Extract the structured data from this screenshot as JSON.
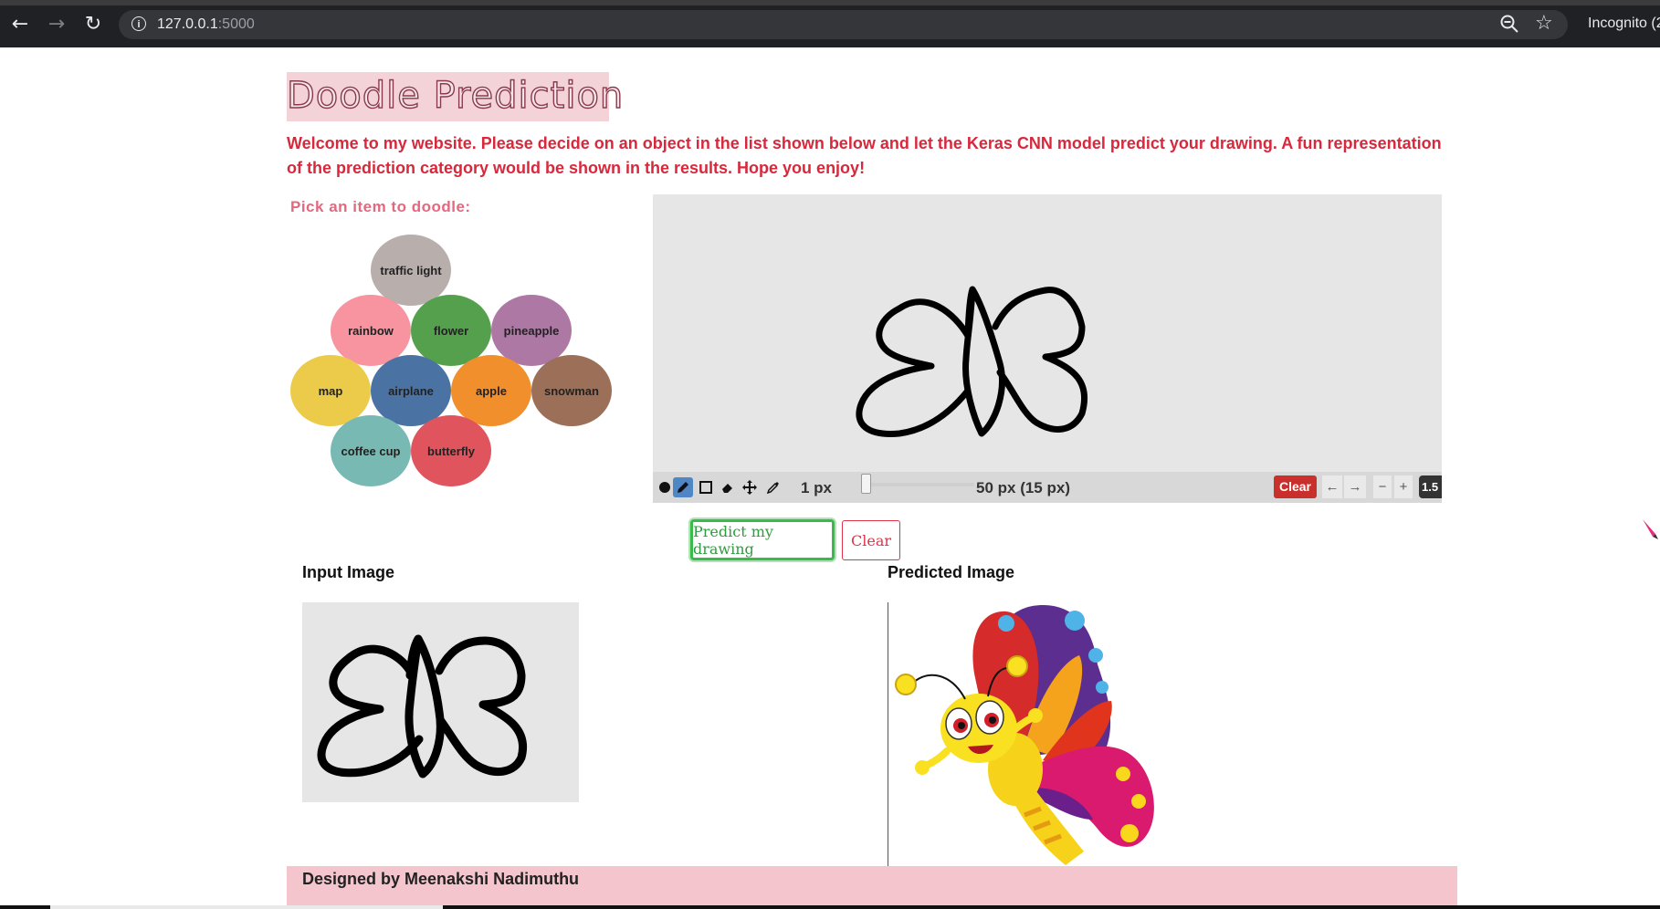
{
  "browser": {
    "url_host": "127.0.0.1",
    "url_port": ":5000",
    "profile": "Incognito (2"
  },
  "page": {
    "title": "Doodle Prediction",
    "welcome": "Welcome to my website. Please decide on an object in the list shown below and let the Keras CNN model predict your drawing. A fun representation of the prediction category would be shown in the results. Hope you enjoy!",
    "pick_label": "Pick an item to doodle:",
    "items": [
      {
        "label": "traffic light",
        "color": "#b8aeac"
      },
      {
        "label": "rainbow",
        "color": "#f893a0"
      },
      {
        "label": "flower",
        "color": "#55a04c"
      },
      {
        "label": "pineapple",
        "color": "#ad78a4"
      },
      {
        "label": "map",
        "color": "#eccb4a"
      },
      {
        "label": "airplane",
        "color": "#4a73a4"
      },
      {
        "label": "apple",
        "color": "#f28f2d"
      },
      {
        "label": "snowman",
        "color": "#9c6f58"
      },
      {
        "label": "coffee cup",
        "color": "#78b9b4"
      },
      {
        "label": "butterfly",
        "color": "#e0545d"
      }
    ]
  },
  "canvas_toolbar": {
    "stroke_size": "1 px",
    "size_readout": "50 px (15 px)",
    "clear_label": "Clear",
    "undo_label": "←",
    "redo_label": "→",
    "zoom_out_label": "−",
    "zoom_in_label": "+",
    "zoom_readout": "1.5"
  },
  "actions": {
    "predict_label": "Predict my drawing",
    "clear_label": "Clear"
  },
  "results": {
    "input_heading": "Input Image",
    "predicted_heading": "Predicted Image"
  },
  "footer": {
    "text": "Designed by Meenakshi Nadimuthu"
  },
  "colors": {
    "accent_red": "#d8283c",
    "title_bg": "#f4d3d8",
    "footer_bg": "#f4c5cd",
    "predict_green": "#3cb94b"
  }
}
